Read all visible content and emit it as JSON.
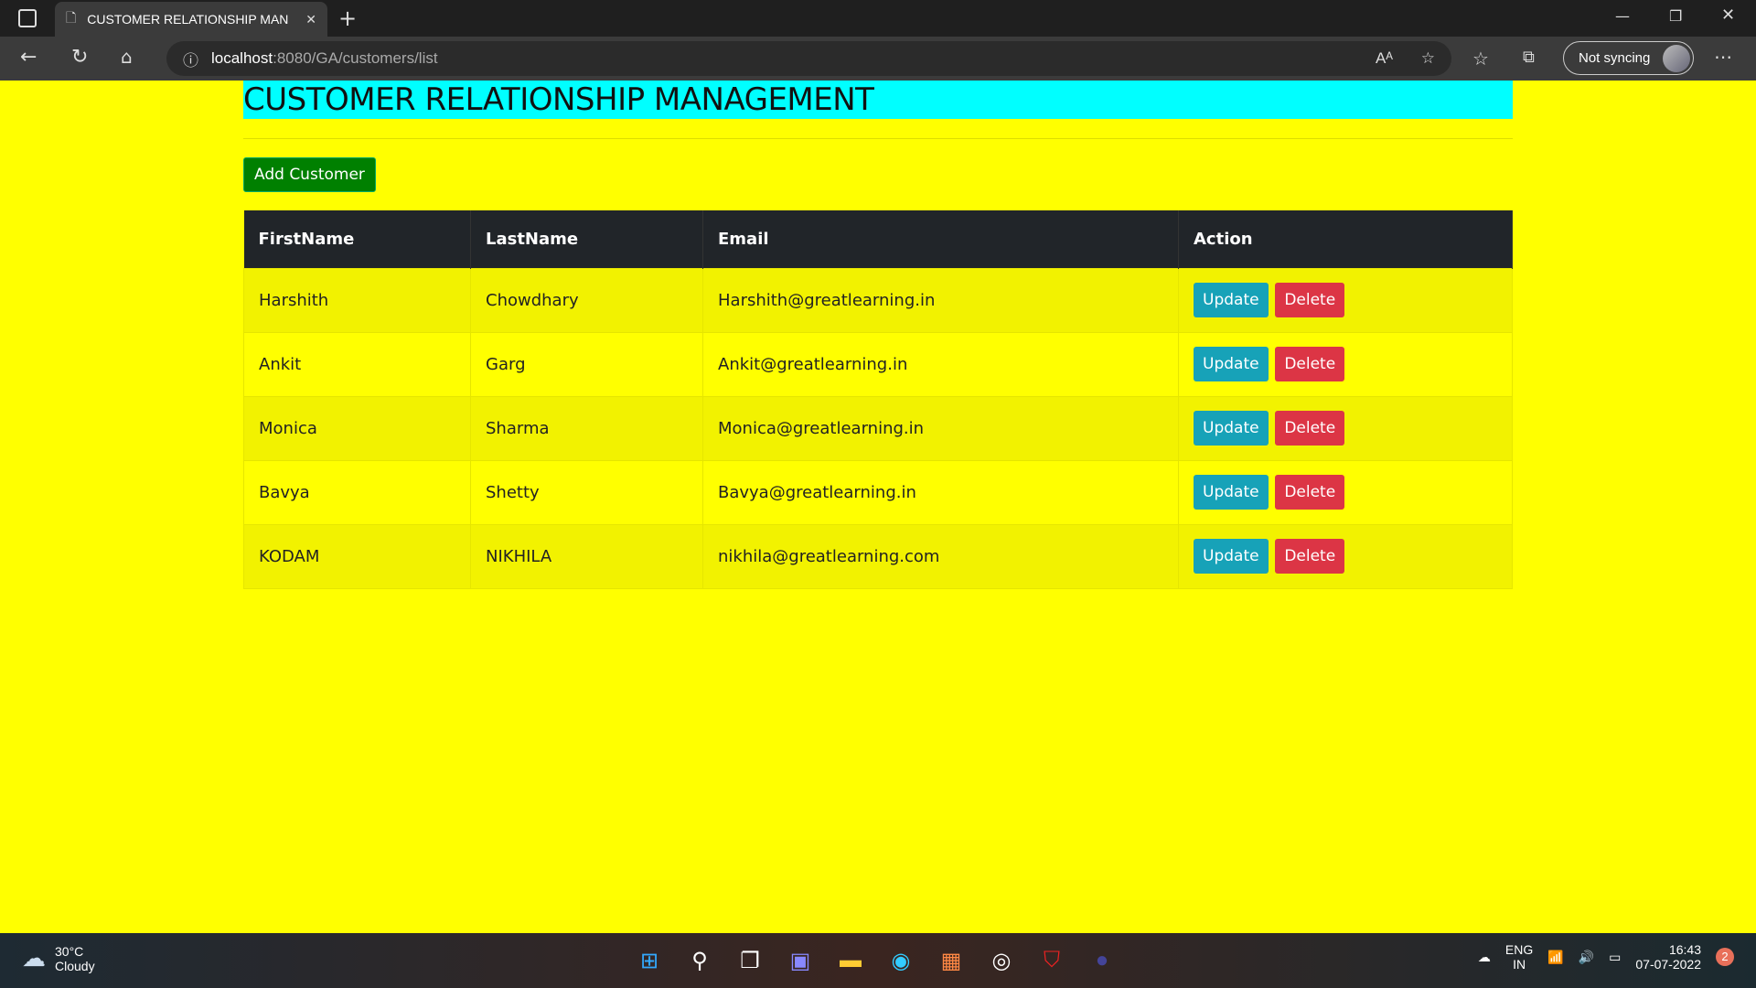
{
  "browser": {
    "tab_title": "CUSTOMER RELATIONSHIP MAN",
    "url_host": "localhost",
    "url_path": ":8080/GA/customers/list",
    "sync_label": "Not syncing"
  },
  "page": {
    "title": "CUSTOMER RELATIONSHIP MANAGEMENT",
    "add_button": "Add Customer",
    "columns": [
      "FirstName",
      "LastName",
      "Email",
      "Action"
    ],
    "rows": [
      {
        "first": "Harshith",
        "last": "Chowdhary",
        "email": "Harshith@greatlearning.in"
      },
      {
        "first": "Ankit",
        "last": "Garg",
        "email": "Ankit@greatlearning.in"
      },
      {
        "first": "Monica",
        "last": "Sharma",
        "email": "Monica@greatlearning.in"
      },
      {
        "first": "Bavya",
        "last": "Shetty",
        "email": "Bavya@greatlearning.in"
      },
      {
        "first": "KODAM",
        "last": "NIKHILA",
        "email": "nikhila@greatlearning.com"
      }
    ],
    "update_label": "Update",
    "delete_label": "Delete"
  },
  "taskbar": {
    "temp": "30°C",
    "weather": "Cloudy",
    "lang1": "ENG",
    "lang2": "IN",
    "time": "16:43",
    "date": "07-07-2022",
    "notifications": "2"
  },
  "colors": {
    "background": "#ffff00",
    "header": "#00ffff",
    "add": "#008000",
    "update": "#17a2b8",
    "delete": "#dc3545"
  }
}
